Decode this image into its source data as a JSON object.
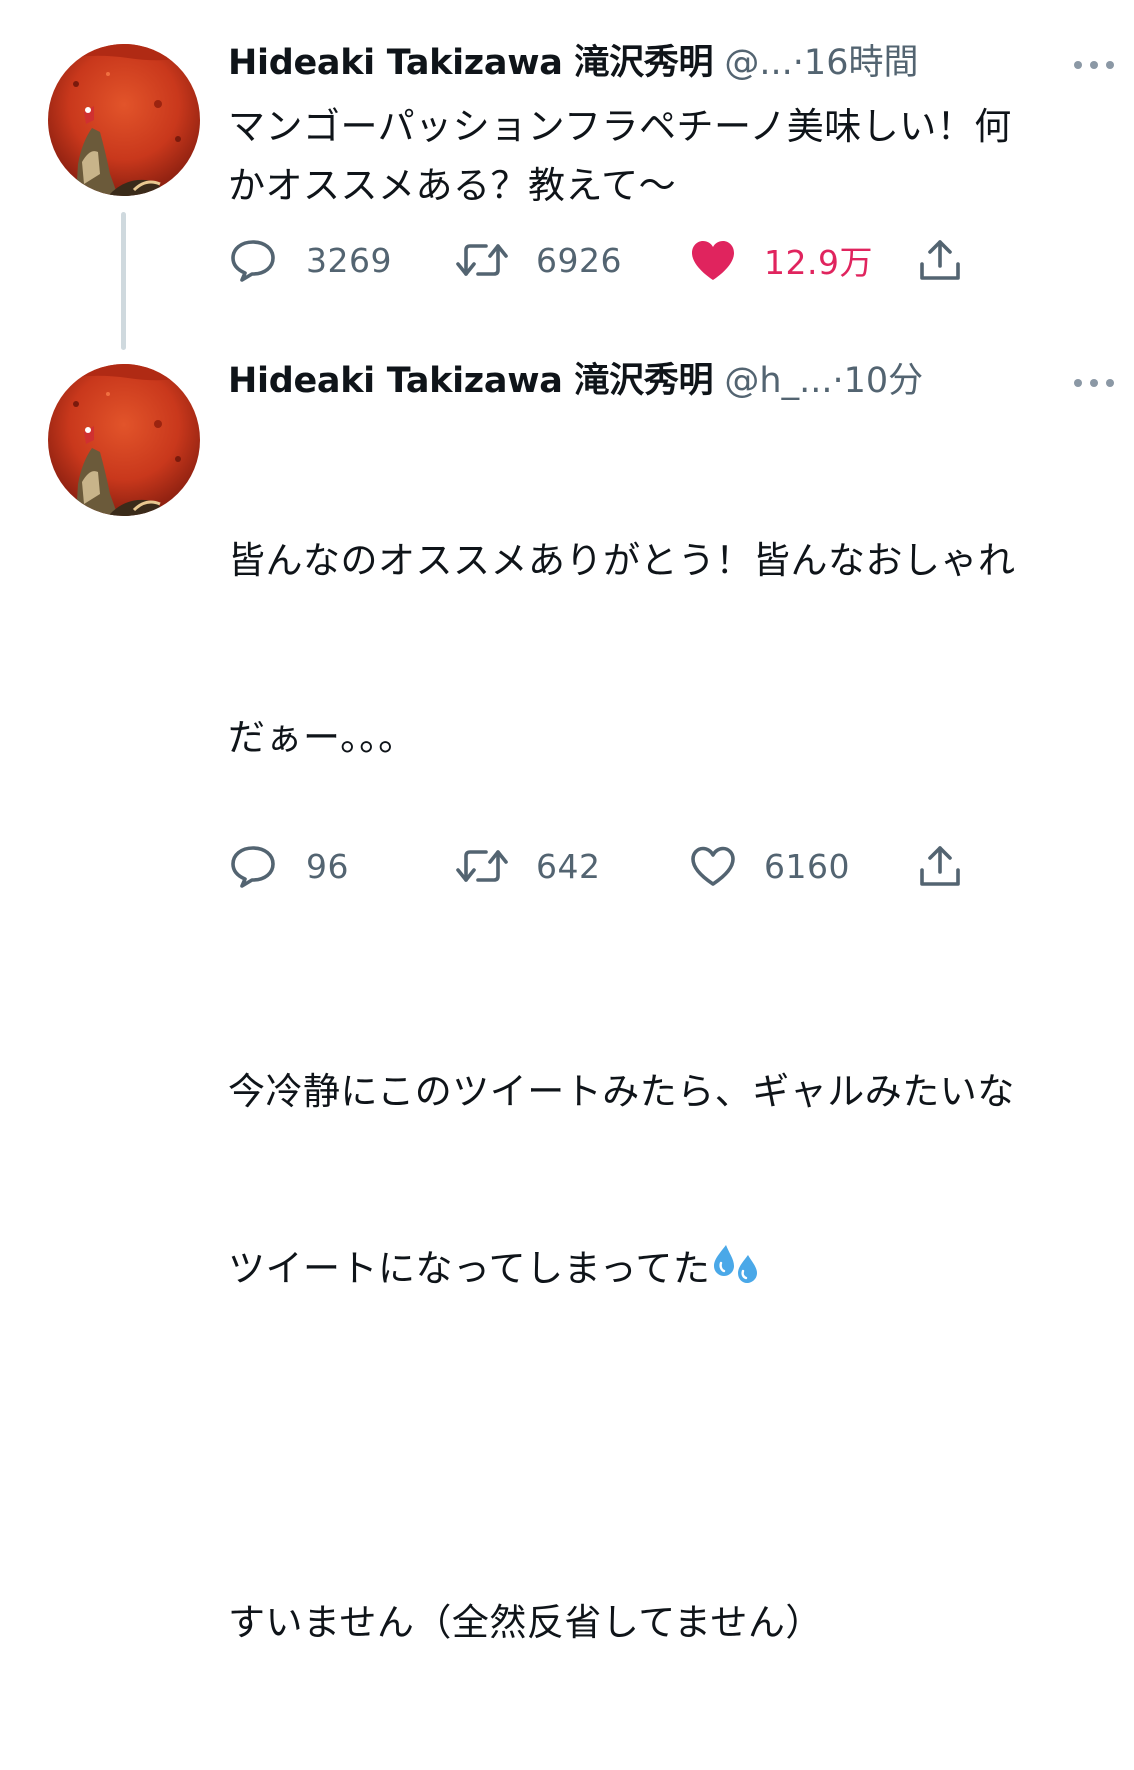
{
  "tweets": [
    {
      "author_name": "Hideaki Takizawa 滝沢秀明",
      "handle": "@...",
      "separator": "·",
      "time": "16時間",
      "text": "マンゴーパッションフラペチーノ美味しい！何\nかオススメある？教えて〜",
      "replies": "3269",
      "retweets": "6926",
      "likes": "12.9万",
      "liked": true
    },
    {
      "author_name": "Hideaki Takizawa 滝沢秀明",
      "handle": "@h_...",
      "separator": "·",
      "time": "10分",
      "text_lines": [
        "皆んなのオススメありがとう！皆んなおしゃれ",
        "だぁー。。。",
        "",
        "今冷静にこのツイートみたら、ギャルみたいな",
        "ツイートになってしまってた",
        "",
        "すいません（全然反省してません）"
      ],
      "replies": "96",
      "retweets": "642",
      "likes": "6160",
      "liked": false
    }
  ],
  "icons": {
    "reply": "reply-bubble-icon",
    "retweet": "retweet-arrows-icon",
    "like": "heart-icon",
    "share": "share-upload-icon",
    "more": "more-dots-icon",
    "emoji": "sweat-droplets-emoji"
  },
  "colors": {
    "text": "#0f1419",
    "secondary": "#536471",
    "like": "#e0245e",
    "thread_line": "#cfd9de"
  }
}
